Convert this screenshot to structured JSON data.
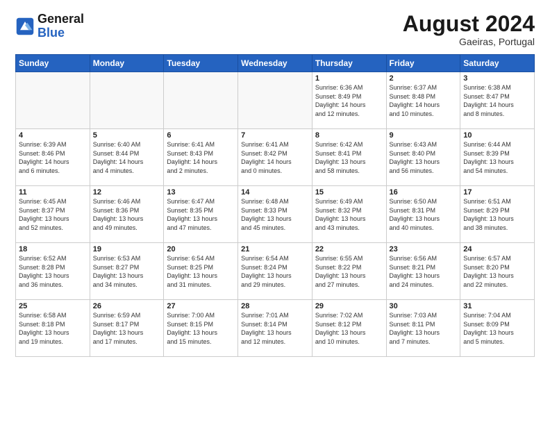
{
  "header": {
    "logo_line1": "General",
    "logo_line2": "Blue",
    "month_title": "August 2024",
    "location": "Gaeiras, Portugal"
  },
  "weekdays": [
    "Sunday",
    "Monday",
    "Tuesday",
    "Wednesday",
    "Thursday",
    "Friday",
    "Saturday"
  ],
  "days": [
    {
      "num": "",
      "info": ""
    },
    {
      "num": "",
      "info": ""
    },
    {
      "num": "",
      "info": ""
    },
    {
      "num": "",
      "info": ""
    },
    {
      "num": "1",
      "info": "Sunrise: 6:36 AM\nSunset: 8:49 PM\nDaylight: 14 hours\nand 12 minutes."
    },
    {
      "num": "2",
      "info": "Sunrise: 6:37 AM\nSunset: 8:48 PM\nDaylight: 14 hours\nand 10 minutes."
    },
    {
      "num": "3",
      "info": "Sunrise: 6:38 AM\nSunset: 8:47 PM\nDaylight: 14 hours\nand 8 minutes."
    },
    {
      "num": "4",
      "info": "Sunrise: 6:39 AM\nSunset: 8:46 PM\nDaylight: 14 hours\nand 6 minutes."
    },
    {
      "num": "5",
      "info": "Sunrise: 6:40 AM\nSunset: 8:44 PM\nDaylight: 14 hours\nand 4 minutes."
    },
    {
      "num": "6",
      "info": "Sunrise: 6:41 AM\nSunset: 8:43 PM\nDaylight: 14 hours\nand 2 minutes."
    },
    {
      "num": "7",
      "info": "Sunrise: 6:41 AM\nSunset: 8:42 PM\nDaylight: 14 hours\nand 0 minutes."
    },
    {
      "num": "8",
      "info": "Sunrise: 6:42 AM\nSunset: 8:41 PM\nDaylight: 13 hours\nand 58 minutes."
    },
    {
      "num": "9",
      "info": "Sunrise: 6:43 AM\nSunset: 8:40 PM\nDaylight: 13 hours\nand 56 minutes."
    },
    {
      "num": "10",
      "info": "Sunrise: 6:44 AM\nSunset: 8:39 PM\nDaylight: 13 hours\nand 54 minutes."
    },
    {
      "num": "11",
      "info": "Sunrise: 6:45 AM\nSunset: 8:37 PM\nDaylight: 13 hours\nand 52 minutes."
    },
    {
      "num": "12",
      "info": "Sunrise: 6:46 AM\nSunset: 8:36 PM\nDaylight: 13 hours\nand 49 minutes."
    },
    {
      "num": "13",
      "info": "Sunrise: 6:47 AM\nSunset: 8:35 PM\nDaylight: 13 hours\nand 47 minutes."
    },
    {
      "num": "14",
      "info": "Sunrise: 6:48 AM\nSunset: 8:33 PM\nDaylight: 13 hours\nand 45 minutes."
    },
    {
      "num": "15",
      "info": "Sunrise: 6:49 AM\nSunset: 8:32 PM\nDaylight: 13 hours\nand 43 minutes."
    },
    {
      "num": "16",
      "info": "Sunrise: 6:50 AM\nSunset: 8:31 PM\nDaylight: 13 hours\nand 40 minutes."
    },
    {
      "num": "17",
      "info": "Sunrise: 6:51 AM\nSunset: 8:29 PM\nDaylight: 13 hours\nand 38 minutes."
    },
    {
      "num": "18",
      "info": "Sunrise: 6:52 AM\nSunset: 8:28 PM\nDaylight: 13 hours\nand 36 minutes."
    },
    {
      "num": "19",
      "info": "Sunrise: 6:53 AM\nSunset: 8:27 PM\nDaylight: 13 hours\nand 34 minutes."
    },
    {
      "num": "20",
      "info": "Sunrise: 6:54 AM\nSunset: 8:25 PM\nDaylight: 13 hours\nand 31 minutes."
    },
    {
      "num": "21",
      "info": "Sunrise: 6:54 AM\nSunset: 8:24 PM\nDaylight: 13 hours\nand 29 minutes."
    },
    {
      "num": "22",
      "info": "Sunrise: 6:55 AM\nSunset: 8:22 PM\nDaylight: 13 hours\nand 27 minutes."
    },
    {
      "num": "23",
      "info": "Sunrise: 6:56 AM\nSunset: 8:21 PM\nDaylight: 13 hours\nand 24 minutes."
    },
    {
      "num": "24",
      "info": "Sunrise: 6:57 AM\nSunset: 8:20 PM\nDaylight: 13 hours\nand 22 minutes."
    },
    {
      "num": "25",
      "info": "Sunrise: 6:58 AM\nSunset: 8:18 PM\nDaylight: 13 hours\nand 19 minutes."
    },
    {
      "num": "26",
      "info": "Sunrise: 6:59 AM\nSunset: 8:17 PM\nDaylight: 13 hours\nand 17 minutes."
    },
    {
      "num": "27",
      "info": "Sunrise: 7:00 AM\nSunset: 8:15 PM\nDaylight: 13 hours\nand 15 minutes."
    },
    {
      "num": "28",
      "info": "Sunrise: 7:01 AM\nSunset: 8:14 PM\nDaylight: 13 hours\nand 12 minutes."
    },
    {
      "num": "29",
      "info": "Sunrise: 7:02 AM\nSunset: 8:12 PM\nDaylight: 13 hours\nand 10 minutes."
    },
    {
      "num": "30",
      "info": "Sunrise: 7:03 AM\nSunset: 8:11 PM\nDaylight: 13 hours\nand 7 minutes."
    },
    {
      "num": "31",
      "info": "Sunrise: 7:04 AM\nSunset: 8:09 PM\nDaylight: 13 hours\nand 5 minutes."
    }
  ]
}
